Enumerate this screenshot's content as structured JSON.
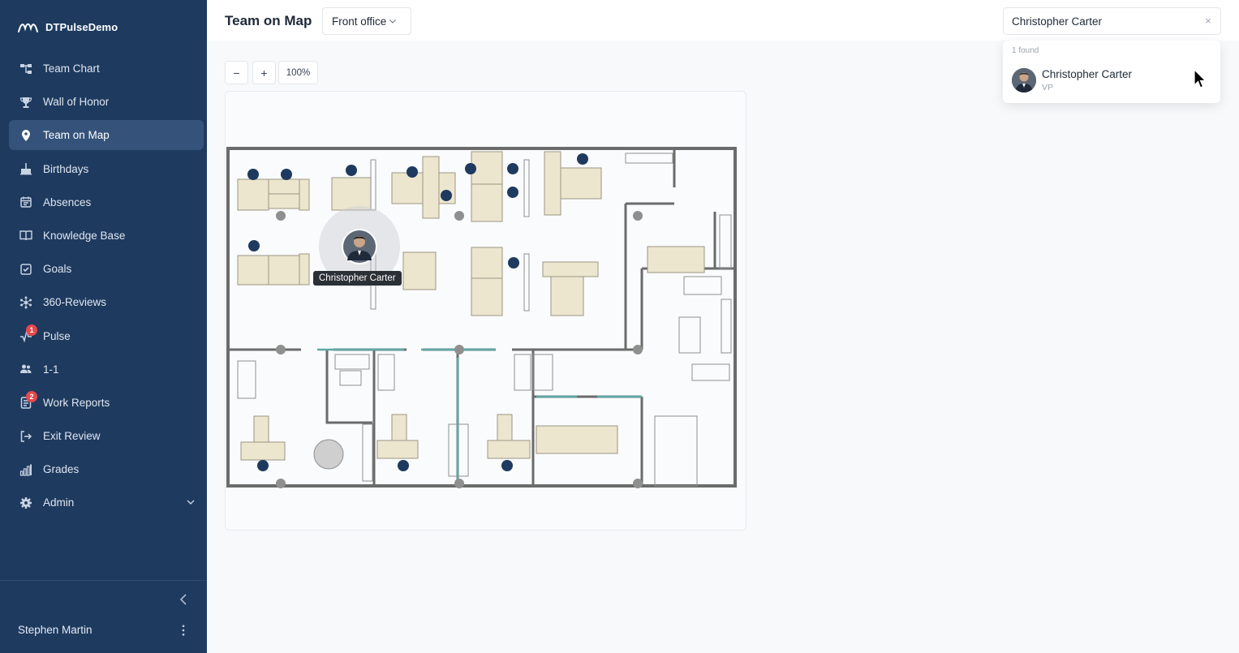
{
  "app": {
    "name": "DTPulseDemo"
  },
  "sidebar": {
    "items": [
      {
        "label": "Team Chart",
        "icon": "org-chart-icon"
      },
      {
        "label": "Wall of Honor",
        "icon": "trophy-icon"
      },
      {
        "label": "Team on Map",
        "icon": "map-pin-icon",
        "active": true
      },
      {
        "label": "Birthdays",
        "icon": "cake-icon"
      },
      {
        "label": "Absences",
        "icon": "calendar-icon"
      },
      {
        "label": "Knowledge Base",
        "icon": "book-icon"
      },
      {
        "label": "Goals",
        "icon": "checkbox-icon"
      },
      {
        "label": "360-Reviews",
        "icon": "network-icon"
      },
      {
        "label": "Pulse",
        "icon": "pulse-icon",
        "badge": "1"
      },
      {
        "label": "1-1",
        "icon": "users-icon"
      },
      {
        "label": "Work Reports",
        "icon": "report-icon",
        "badge": "2"
      },
      {
        "label": "Exit Review",
        "icon": "exit-icon"
      },
      {
        "label": "Grades",
        "icon": "bar-chart-icon"
      },
      {
        "label": "Admin",
        "icon": "gear-icon",
        "expandable": true
      }
    ],
    "user": {
      "name": "Stephen Martin"
    }
  },
  "header": {
    "title": "Team on Map",
    "office_select": {
      "value": "Front office"
    },
    "search": {
      "value": "Christopher Carter",
      "clear": "×"
    }
  },
  "search_results": {
    "count_label": "1 found",
    "items": [
      {
        "name": "Christopher Carter",
        "role": "VP"
      }
    ]
  },
  "map": {
    "zoom_out": "−",
    "zoom_in": "+",
    "zoom_level": "100%",
    "highlighted_person": "Christopher Carter"
  },
  "colors": {
    "sidebar_bg": "#1e3a5f",
    "active_item": "#35537a",
    "desk": "#ede6cf",
    "occupant_dot": "#1e3a5f",
    "badge": "#e5484d"
  }
}
